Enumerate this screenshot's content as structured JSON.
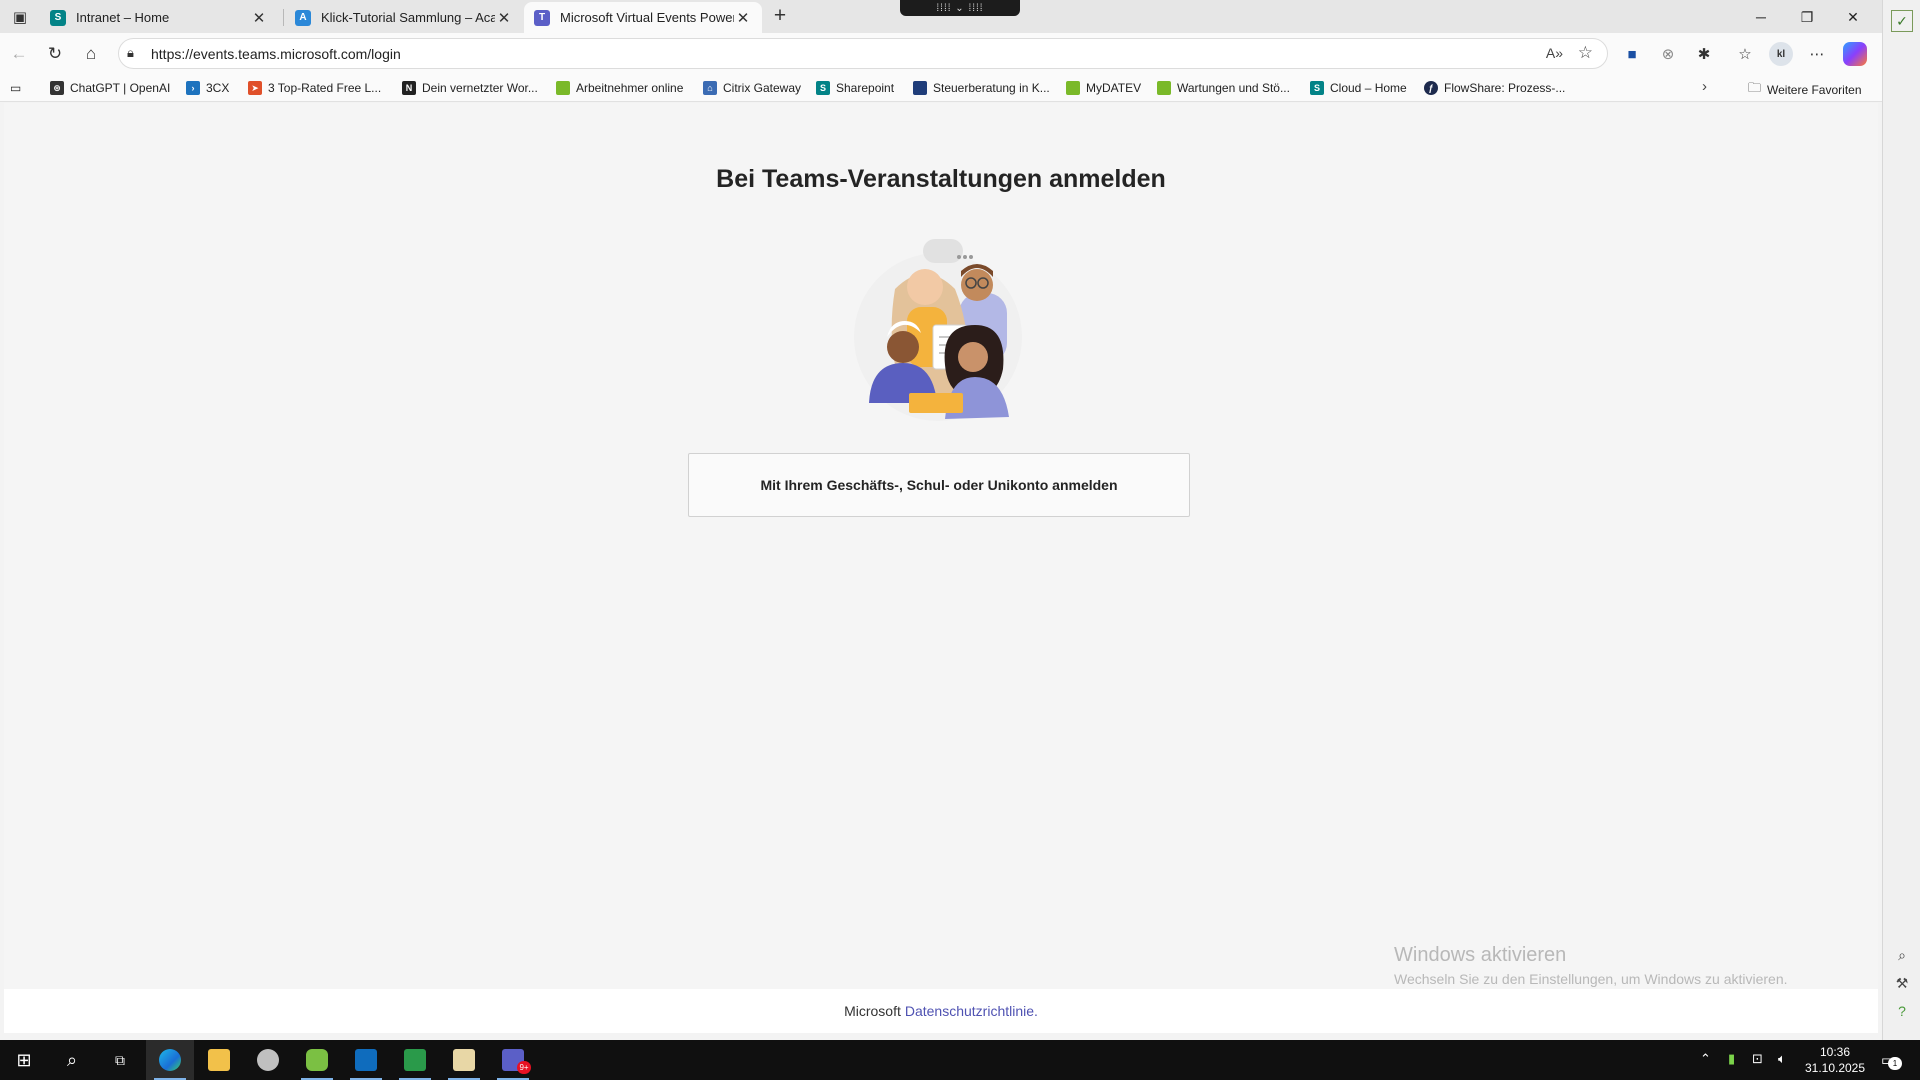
{
  "tabs": [
    {
      "title": "Intranet – Home",
      "favicon": "sharepoint-icon",
      "color": "#038387",
      "active": false
    },
    {
      "title": "Klick-Tutorial Sammlung – Acade",
      "favicon": "academy-icon",
      "color": "#2b88d8",
      "active": false
    },
    {
      "title": "Microsoft Virtual Events Powered",
      "favicon": "teams-icon",
      "color": "#5b5fc7",
      "active": true
    }
  ],
  "address": {
    "url": "https://events.teams.microsoft.com/login"
  },
  "avatar_text": "kl",
  "favorites": [
    {
      "label": "ChatGPT | OpenAI",
      "icon": "openai-icon",
      "color": "#333333"
    },
    {
      "label": "3CX",
      "icon": "3cx-icon",
      "color": "#1e73be"
    },
    {
      "label": "3 Top-Rated Free L...",
      "icon": "arrow-icon",
      "color": "#e0502a"
    },
    {
      "label": "Dein vernetzter Wor...",
      "icon": "notion-icon",
      "color": "#222222"
    },
    {
      "label": "Arbeitnehmer online",
      "icon": "datev-icon",
      "color": "#7ab929"
    },
    {
      "label": "Citrix Gateway",
      "icon": "citrix-icon",
      "color": "#3b6bb3"
    },
    {
      "label": "Sharepoint",
      "icon": "sharepoint-icon",
      "color": "#038387"
    },
    {
      "label": "Steuerberatung in K...",
      "icon": "square-icon",
      "color": "#1f3d7a"
    },
    {
      "label": "MyDATEV",
      "icon": "datev-icon",
      "color": "#7ab929"
    },
    {
      "label": "Wartungen und Stö...",
      "icon": "datev-icon",
      "color": "#7ab929"
    },
    {
      "label": "Cloud – Home",
      "icon": "sharepoint-icon",
      "color": "#038387"
    },
    {
      "label": "FlowShare: Prozess-...",
      "icon": "flowshare-icon",
      "color": "#1d2a4d"
    }
  ],
  "favorites_more": "Weitere Favoriten",
  "page": {
    "heading": "Bei Teams-Veranstaltungen anmelden",
    "signin_button": "Mit Ihrem Geschäfts-, Schul- oder Unikonto anmelden",
    "footer_brand": "Microsoft",
    "footer_link": "Datenschutzrichtlinie."
  },
  "watermark": {
    "title": "Windows aktivieren",
    "subtitle": "Wechseln Sie zu den Einstellungen, um Windows zu aktivieren."
  },
  "clock": {
    "time": "10:36",
    "date": "31.10.2025"
  },
  "taskbar_badges": {
    "teams": "9+",
    "notifications": "1"
  }
}
